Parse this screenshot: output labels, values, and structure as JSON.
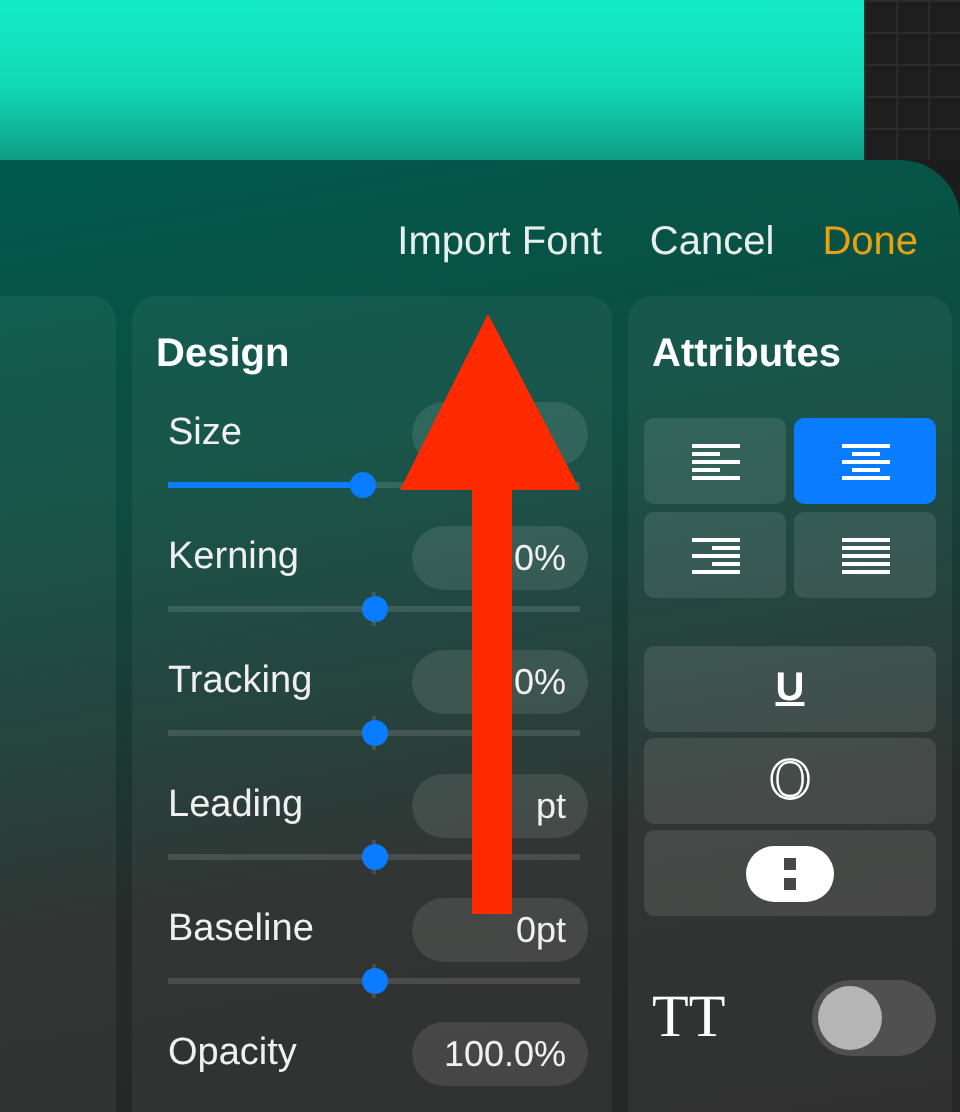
{
  "header": {
    "buttons": [
      {
        "label": "Import Font",
        "kind": "plain"
      },
      {
        "label": "Cancel",
        "kind": "plain"
      },
      {
        "label": "Done",
        "kind": "primary"
      }
    ]
  },
  "design": {
    "title": "Design",
    "rows": [
      {
        "label": "Size",
        "level": 0.47,
        "kind": "filled"
      },
      {
        "label": "Kerning",
        "value": "0%",
        "level": 0.5,
        "kind": "centered"
      },
      {
        "label": "Tracking",
        "value": "0%",
        "level": 0.5,
        "kind": "centered"
      },
      {
        "label": "Leading",
        "value": "pt",
        "level": 0.5,
        "kind": "centered"
      },
      {
        "label": "Baseline",
        "value": "0pt",
        "level": 0.5,
        "kind": "centered"
      },
      {
        "label": "Opacity",
        "value": "100.0%"
      }
    ]
  },
  "attributes": {
    "title": "Attributes",
    "alignments": [
      {
        "kind": "left",
        "selected": false
      },
      {
        "kind": "center",
        "selected": true
      },
      {
        "kind": "right",
        "selected": false
      },
      {
        "kind": "justify",
        "selected": false
      }
    ],
    "styles": [
      {
        "kind": "underline",
        "label": "U"
      },
      {
        "kind": "outline",
        "label": "O"
      },
      {
        "kind": "capsule"
      }
    ],
    "caps": {
      "label": "TT",
      "on": false
    }
  }
}
